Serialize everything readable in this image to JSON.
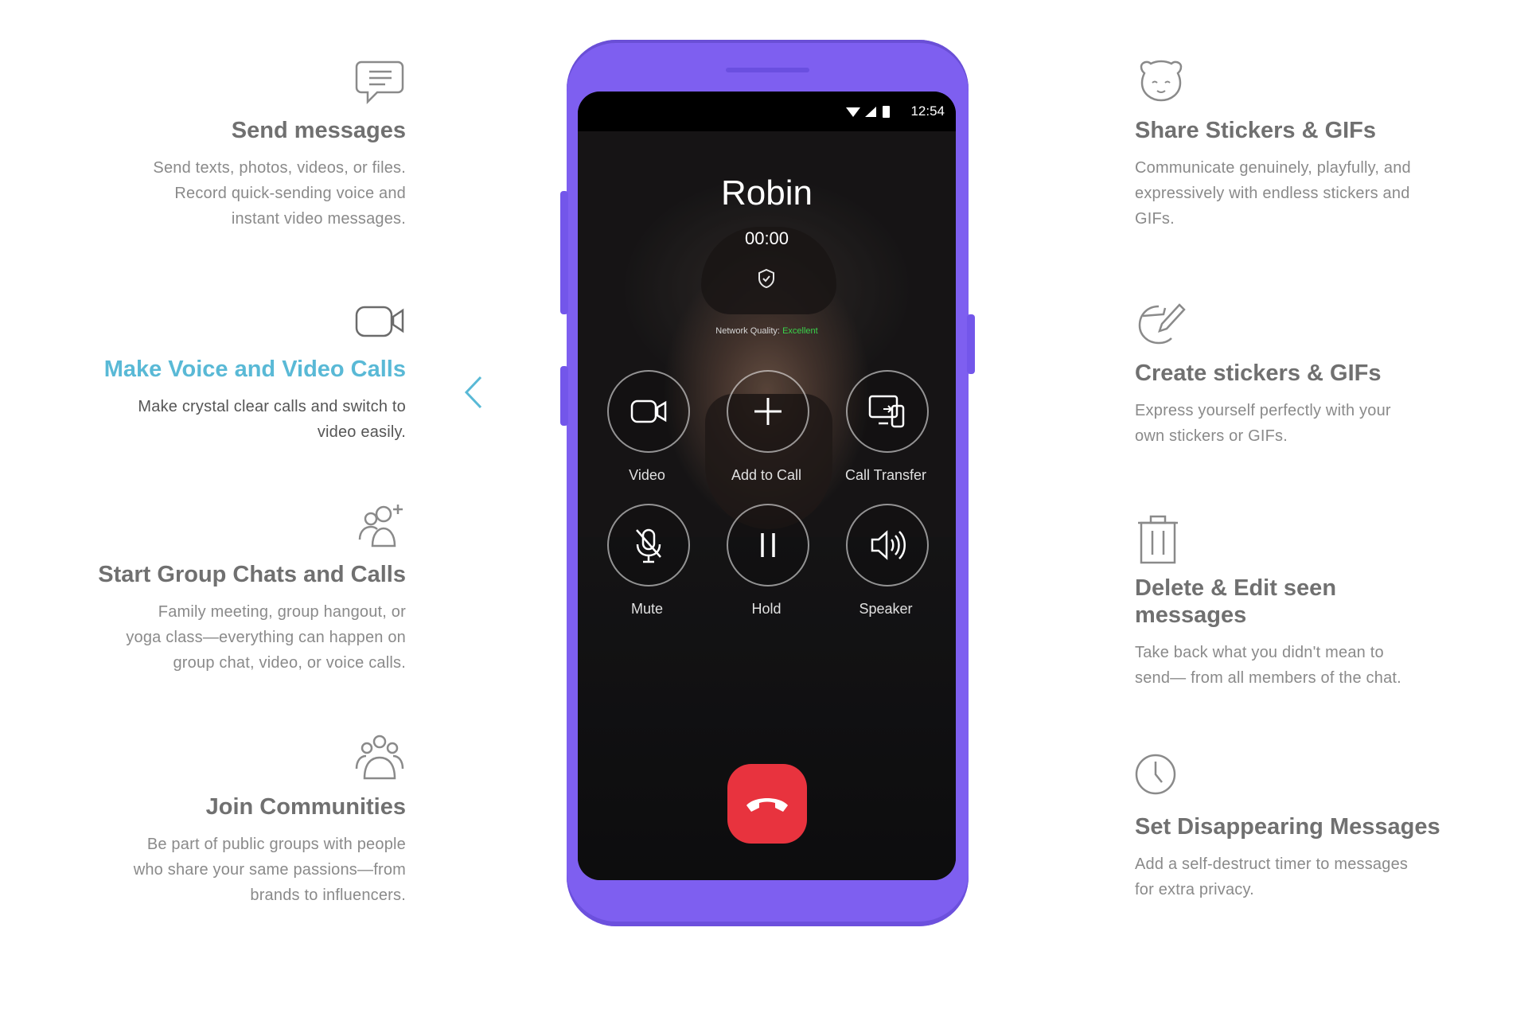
{
  "features_left": [
    {
      "icon": "chat-bubble-icon",
      "title": "Send messages",
      "desc": [
        "Send texts, photos, videos, or files.",
        "Record quick-sending voice and",
        "instant video messages."
      ],
      "active": false
    },
    {
      "icon": "video-camera-icon",
      "title": "Make Voice and Video Calls",
      "desc": [
        "Make crystal clear calls and switch to",
        "video easily."
      ],
      "active": true
    },
    {
      "icon": "add-people-icon",
      "title": "Start Group Chats and Calls",
      "desc": [
        "Family meeting, group hangout, or",
        "yoga class—everything can happen on",
        "group chat, video, or voice calls."
      ],
      "active": false
    },
    {
      "icon": "community-icon",
      "title": "Join Communities",
      "desc": [
        "Be part of public groups with people",
        "who share your same passions—from",
        "brands to influencers."
      ],
      "active": false
    }
  ],
  "features_right": [
    {
      "icon": "bear-sticker-icon",
      "title": "Share Stickers & GIFs",
      "desc": [
        "Communicate genuinely, playfully, and",
        "expressively with endless stickers and",
        "GIFs."
      ]
    },
    {
      "icon": "pencil-sticker-icon",
      "title": "Create stickers & GIFs",
      "desc": [
        "Express yourself perfectly with your",
        "own stickers or GIFs."
      ]
    },
    {
      "icon": "trash-icon",
      "title": "Delete & Edit seen messages",
      "title_lines": [
        "Delete & Edit seen",
        "messages"
      ],
      "desc": [
        "Take back what you didn't mean to",
        "send— from all members of the chat."
      ]
    },
    {
      "icon": "clock-icon",
      "title": "Set Disappearing Messages",
      "desc": [
        "Add a self-destruct timer to messages",
        "for extra privacy."
      ]
    }
  ],
  "phone": {
    "status_time": "12:54",
    "caller_name": "Robin",
    "call_timer": "00:00",
    "network_label": "Network Quality:",
    "network_value": "Excellent",
    "buttons_row1": [
      {
        "label": "Video",
        "icon": "video-icon"
      },
      {
        "label": "Add to Call",
        "icon": "plus-icon"
      },
      {
        "label": "Call Transfer",
        "icon": "transfer-devices-icon"
      }
    ],
    "buttons_row2": [
      {
        "label": "Mute",
        "icon": "mic-off-icon"
      },
      {
        "label": "Hold",
        "icon": "pause-icon"
      },
      {
        "label": "Speaker",
        "icon": "speaker-icon"
      }
    ],
    "end_call_icon": "phone-hangup-icon"
  },
  "colors": {
    "accent": "#59b9d6",
    "phone": "#7e5ff0",
    "end_call": "#e8333e",
    "network_good": "#3ad24b"
  }
}
